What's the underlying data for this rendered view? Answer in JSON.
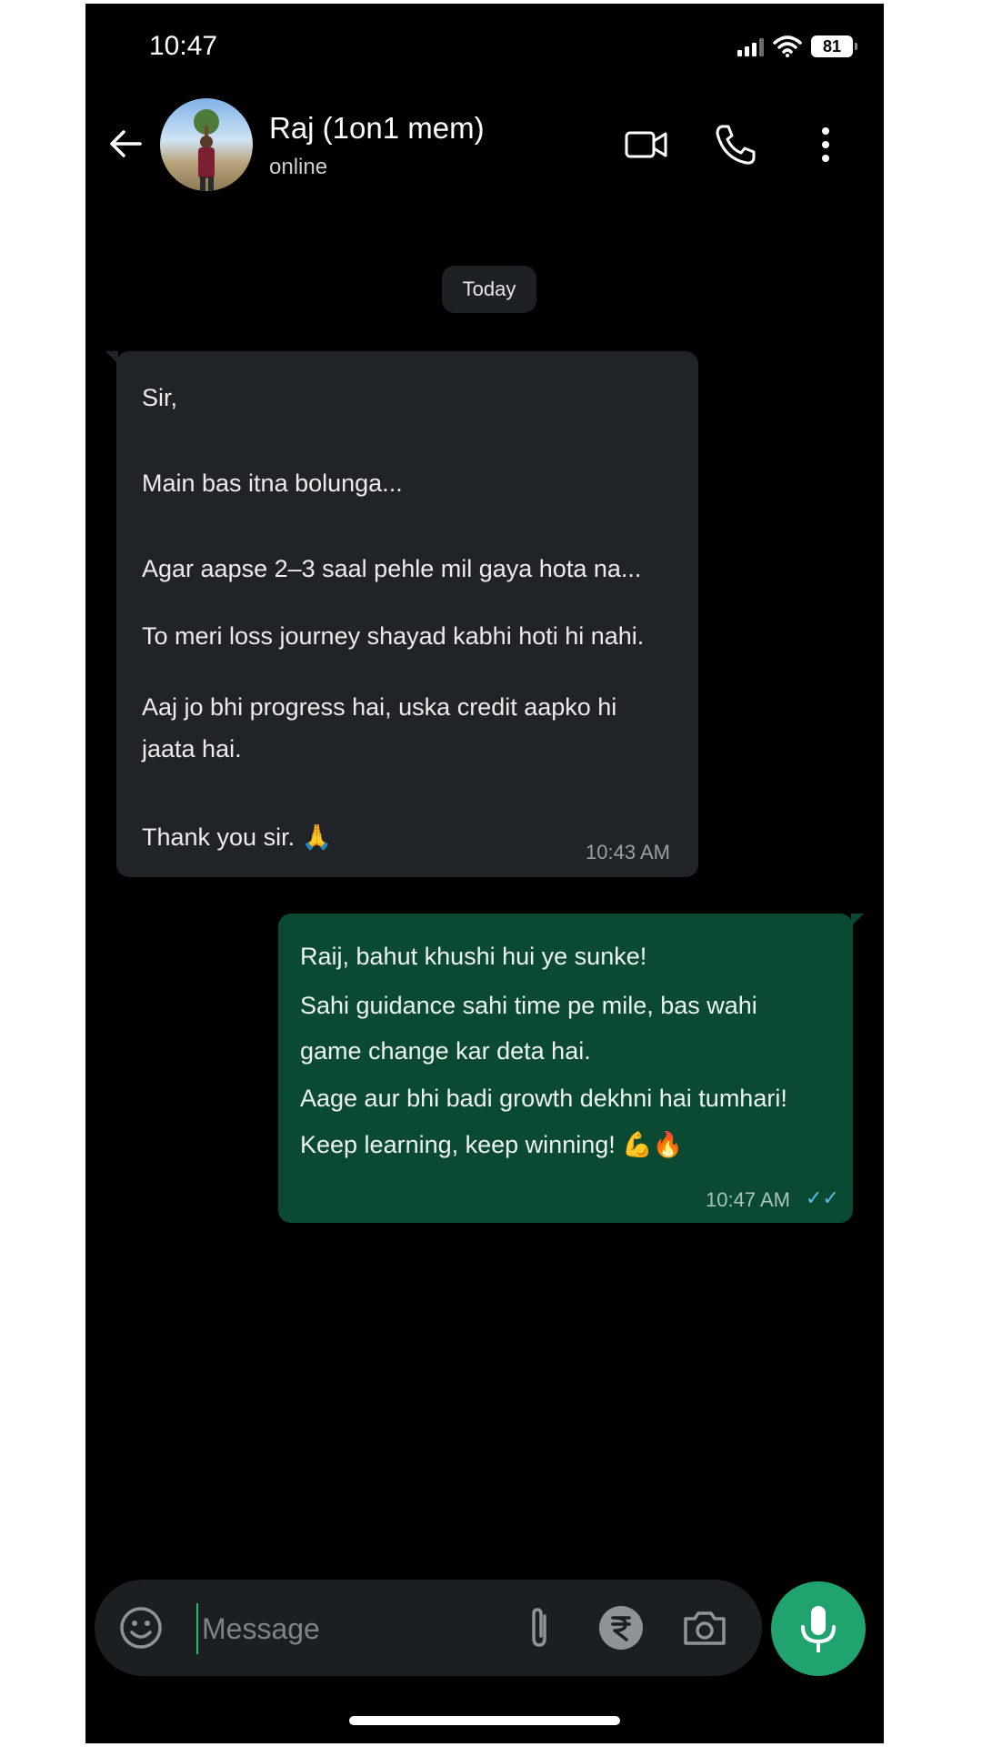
{
  "status_bar": {
    "time": "10:47",
    "battery": "81"
  },
  "header": {
    "name": "Raj (1on1 mem)",
    "status": "online"
  },
  "date_chip": "Today",
  "incoming": {
    "lines": [
      "Sir,",
      "Main bas itna bolunga...",
      "Agar aapse 2–3 saal pehle mil gaya hota na...",
      "To meri loss journey shayad kabhi hoti hi nahi.",
      "Aaj jo bhi progress hai, uska credit aapko hi",
      "jaata hai.",
      "Thank you sir. 🙏"
    ],
    "time": "10:43 AM"
  },
  "outgoing": {
    "lines": [
      "Raij, bahut khushi hui ye sunke!",
      "Sahi guidance sahi time pe mile, bas wahi",
      "game change kar deta hai.",
      "Aage aur bhi badi growth dekhni hai tumhari!",
      "Keep learning, keep winning! 💪🔥"
    ],
    "time": "10:47 AM",
    "receipt": "✓✓"
  },
  "composer": {
    "placeholder": "Message"
  },
  "colors": {
    "incoming_bubble": "#202428",
    "outgoing_bubble": "#0a4a33",
    "accent": "#21a36f",
    "read_receipt": "#53bdeb"
  },
  "icons": [
    "back-arrow-icon",
    "video-call-icon",
    "phone-icon",
    "more-options-icon",
    "emoji-icon",
    "attach-icon",
    "rupee-payment-icon",
    "camera-icon",
    "mic-icon"
  ]
}
